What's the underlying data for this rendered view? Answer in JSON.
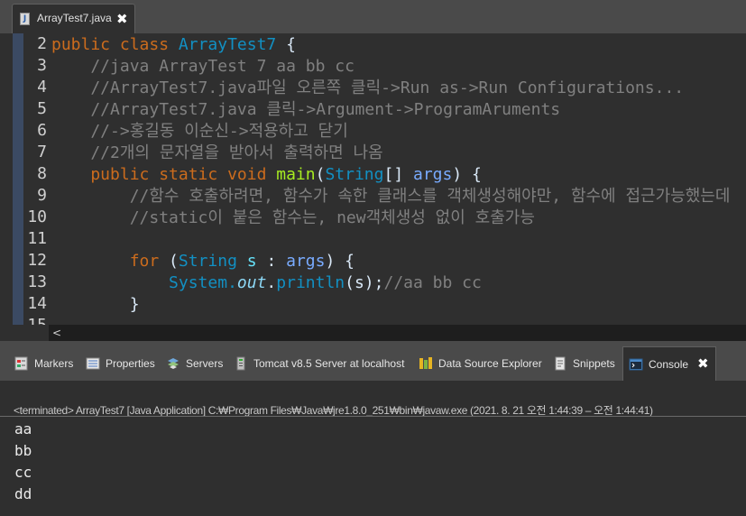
{
  "editor": {
    "tab_title": "ArrayTest7.java",
    "tab_icon": "java-file-icon",
    "lines": [
      {
        "num": "2",
        "segments": [
          {
            "t": "public class ",
            "c": "kw"
          },
          {
            "t": "ArrayTest7",
            "c": "cls"
          },
          {
            "t": " {",
            "c": "plain"
          }
        ]
      },
      {
        "num": "3",
        "segments": [
          {
            "t": "    //java ArrayTest 7 aa bb cc",
            "c": "cmt"
          }
        ]
      },
      {
        "num": "4",
        "segments": [
          {
            "t": "    //ArrayTest7.java파일 오른쪽 클릭->Run as->Run Configurations...",
            "c": "cmt"
          }
        ]
      },
      {
        "num": "5",
        "segments": [
          {
            "t": "    //ArrayTest7.java 클릭->Argument->ProgramAruments",
            "c": "cmt"
          }
        ]
      },
      {
        "num": "6",
        "segments": [
          {
            "t": "    //->홍길동 이순신->적용하고 닫기",
            "c": "cmt"
          }
        ]
      },
      {
        "num": "7",
        "segments": [
          {
            "t": "    //2개의 문자열을 받아서 출력하면 나옴",
            "c": "cmt"
          }
        ]
      },
      {
        "num": "8",
        "segments": [
          {
            "t": "    public static void ",
            "c": "kw"
          },
          {
            "t": "main",
            "c": "fn"
          },
          {
            "t": "(",
            "c": "plain"
          },
          {
            "t": "String",
            "c": "cls"
          },
          {
            "t": "[] ",
            "c": "plain"
          },
          {
            "t": "args",
            "c": "par"
          },
          {
            "t": ") {",
            "c": "plain"
          }
        ]
      },
      {
        "num": "9",
        "segments": [
          {
            "t": "        //함수 호출하려면, 함수가 속한 클래스를 객체생성해야만, 함수에 접근가능했는데",
            "c": "cmt"
          }
        ]
      },
      {
        "num": "10",
        "segments": [
          {
            "t": "        //static이 붙은 함수는, new객체생성 없이 호출가능",
            "c": "cmt"
          }
        ]
      },
      {
        "num": "11",
        "segments": [
          {
            "t": "",
            "c": "plain"
          }
        ]
      },
      {
        "num": "12",
        "segments": [
          {
            "t": "        for ",
            "c": "kw"
          },
          {
            "t": "(",
            "c": "plain"
          },
          {
            "t": "String",
            "c": "cls"
          },
          {
            "t": " ",
            "c": "plain"
          },
          {
            "t": "s",
            "c": "var"
          },
          {
            "t": " : ",
            "c": "plain"
          },
          {
            "t": "args",
            "c": "par"
          },
          {
            "t": ") {",
            "c": "plain"
          }
        ]
      },
      {
        "num": "13",
        "segments": [
          {
            "t": "            System.",
            "c": "cls"
          },
          {
            "t": "out",
            "c": "fld"
          },
          {
            "t": ".",
            "c": "plain"
          },
          {
            "t": "println",
            "c": "cls"
          },
          {
            "t": "(s);",
            "c": "plain"
          },
          {
            "t": "//aa bb cc",
            "c": "cmt"
          }
        ]
      },
      {
        "num": "14",
        "segments": [
          {
            "t": "        }",
            "c": "plain"
          }
        ]
      },
      {
        "num": "15",
        "segments": [
          {
            "t": "",
            "c": "plain"
          }
        ]
      }
    ],
    "scroll_left_arrow": "<"
  },
  "panel": {
    "tabs": [
      {
        "label": "Markers",
        "icon": "markers-icon"
      },
      {
        "label": "Properties",
        "icon": "properties-icon"
      },
      {
        "label": "Servers",
        "icon": "servers-icon"
      },
      {
        "label": "Tomcat v8.5 Server at localhost",
        "icon": "tomcat-icon"
      },
      {
        "label": "Data Source Explorer",
        "icon": "data-source-icon"
      },
      {
        "label": "Snippets",
        "icon": "snippets-icon"
      },
      {
        "label": "Console",
        "icon": "console-icon",
        "active": true
      }
    ],
    "close_glyph": "✖"
  },
  "console": {
    "status": "<terminated> ArrayTest7 [Java Application] C:₩Program Files₩Java₩jre1.8.0_251₩bin₩javaw.exe  (2021. 8. 21 오전 1:44:39 – 오전 1:44:41)",
    "output": [
      "aa",
      "bb",
      "cc",
      "dd"
    ]
  },
  "colors": {
    "keyword": "#cc6c1d",
    "class": "#1290c3",
    "comment": "#808080",
    "background": "#2f2f2f"
  }
}
